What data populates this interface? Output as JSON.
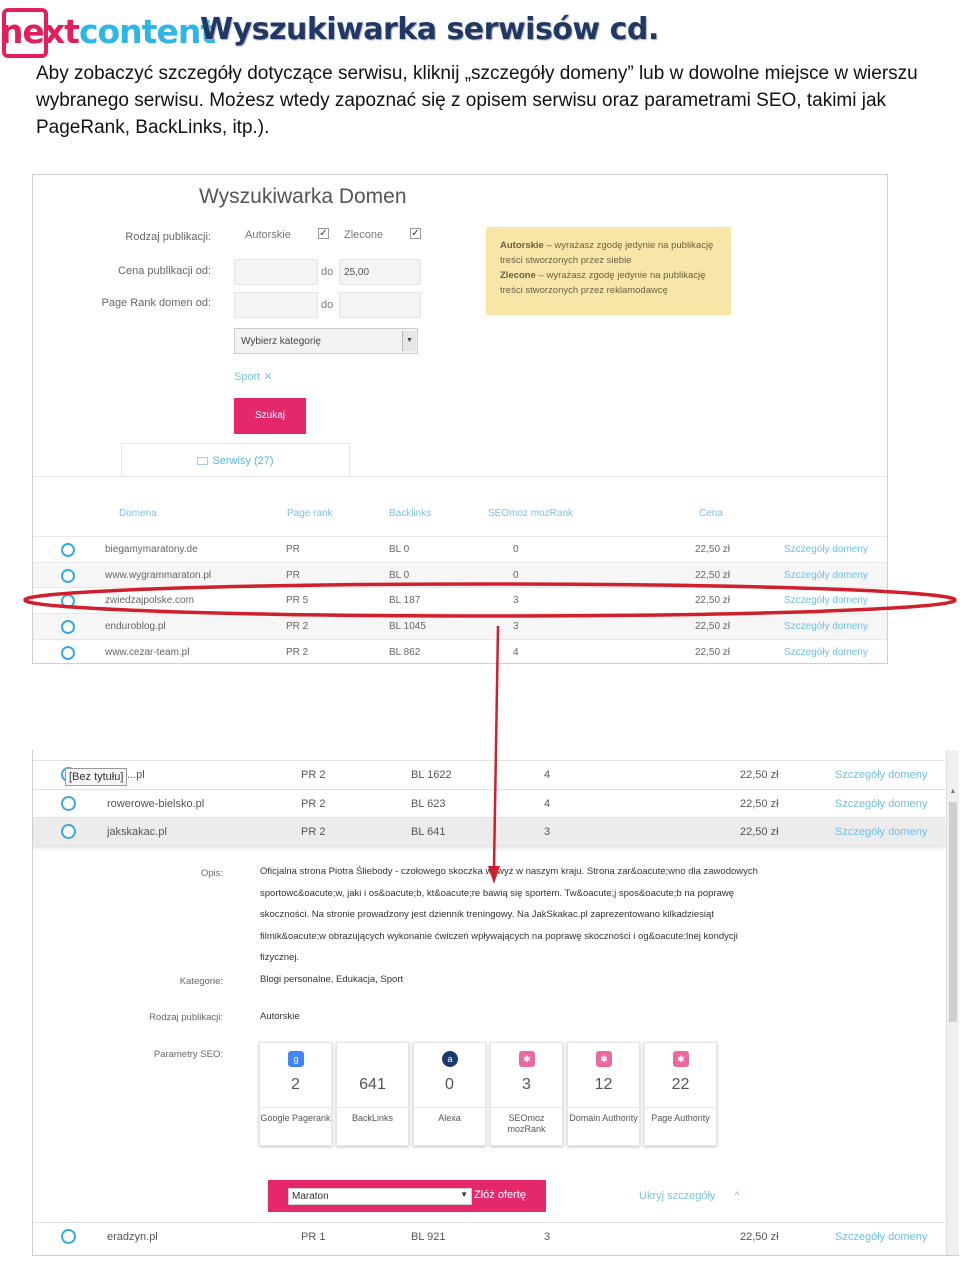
{
  "header": {
    "logo_part1": "next",
    "logo_part2": "content",
    "title": "Wyszukiwarka serwisów cd.",
    "intro": "Aby zobaczyć szczegóły dotyczące serwisu, kliknij „szczegóły domeny” lub w dowolne miejsce w wierszu wybranego serwisu. Możesz wtedy zapoznać się z opisem serwisu oraz parametrami SEO, takimi jak PageRank, BackLinks, itp.)."
  },
  "search": {
    "title": "Wyszukiwarka Domen",
    "pub_type_label": "Rodzaj publikacji:",
    "opt_autorskie": "Autorskie",
    "opt_zlecone": "Zlecone",
    "price_label": "Cena publikacji od:",
    "price_to_label": "do",
    "price_to_value": "25,00",
    "pagerank_label": "Page Rank domen od:",
    "pagerank_to_label": "do",
    "category_select": "Wybierz kategorię",
    "category_tag": "Sport ✕",
    "search_button": "Szukaj",
    "note_autorskie_title": "Autorskie",
    "note_autorskie_text": " – wyrażasz zgodę jedynie na publikację treści stworzonych przez siebie",
    "note_zlecone_title": "Zlecone",
    "note_zlecone_text": " – wyrażasz zgodę jedynie na publikację treści stworzonych przez reklamodawcę",
    "tab_label": "Serwisy (27)"
  },
  "table1": {
    "columns": [
      "Domena",
      "Page rank",
      "Backlinks",
      "SEOmoz mozRank",
      "Cena"
    ],
    "rows": [
      {
        "domain": "biegamymaratony.de",
        "pr": "PR",
        "bl": "BL 0",
        "moz": "0",
        "price": "22,50 zł",
        "link": "Szczegóły domeny"
      },
      {
        "domain": "www.wygrammaraton.pl",
        "pr": "PR",
        "bl": "BL 0",
        "moz": "0",
        "price": "22,50 zł",
        "link": "Szczegóły domeny"
      },
      {
        "domain": "zwiedzajpolske.com",
        "pr": "PR 5",
        "bl": "BL 187",
        "moz": "3",
        "price": "22,50 zł",
        "link": "Szczegóły domeny"
      },
      {
        "domain": "enduroblog.pl",
        "pr": "PR 2",
        "bl": "BL 1045",
        "moz": "3",
        "price": "22,50 zł",
        "link": "Szczegóły domeny"
      },
      {
        "domain": "www.cezar-team.pl",
        "pr": "PR 2",
        "bl": "BL 862",
        "moz": "4",
        "price": "22,50 zł",
        "link": "Szczegóły domeny"
      }
    ]
  },
  "table2": {
    "tooltip": "[Bez tytułu]",
    "rows": [
      {
        "domain": "...pl",
        "pr": "PR 2",
        "bl": "BL 1622",
        "moz": "4",
        "price": "22,50 zł",
        "link": "Szczegóły domeny"
      },
      {
        "domain": "rowerowe-bielsko.pl",
        "pr": "PR 2",
        "bl": "BL 623",
        "moz": "4",
        "price": "22,50 zł",
        "link": "Szczegóły domeny"
      },
      {
        "domain": "jakskakac.pl",
        "pr": "PR 2",
        "bl": "BL 641",
        "moz": "3",
        "price": "22,50 zł",
        "link": "Szczegóły domeny"
      }
    ],
    "last_row": {
      "domain": "eradzyn.pl",
      "pr": "PR 1",
      "bl": "BL 921",
      "moz": "3",
      "price": "22,50 zł",
      "link": "Szczegóły domeny"
    }
  },
  "details": {
    "opis_label": "Opis:",
    "opis_text": "Oficjalna strona Piotra Śliebody - czołowego skoczka wzwyż w naszym kraju. Strona zar&oacute;wno dla zawodowych sportowc&oacute;w, jaki i os&oacute;b, kt&oacute;re bawią się sportem. Tw&oacute;j spos&oacute;b na poprawę skoczności. Na stronie prowadzony jest dziennik treningowy. Na JakSkakac.pl zaprezentowano kilkadziesiąt filmik&oacute;w obrazujących wykonanie ćwiczeń wpływających na poprawę skoczności i og&oacute;lnej kondycji fizycznej.",
    "kategorie_label": "Kategorie:",
    "kategorie_text": "Blogi personalne, Edukacja, Sport",
    "rodzaj_label": "Rodzaj publikacji:",
    "rodzaj_text": "Autorskie",
    "seo_label": "Parametry SEO:",
    "seo": [
      {
        "value": "2",
        "caption": "Google Pagerank",
        "icon": "google-icon"
      },
      {
        "value": "641",
        "caption": "BackLinks",
        "icon": "none"
      },
      {
        "value": "0",
        "caption": "Alexa",
        "icon": "alexa-icon"
      },
      {
        "value": "3",
        "caption": "SEOmoz mozRank",
        "icon": "moz-icon"
      },
      {
        "value": "12",
        "caption": "Domain Authority",
        "icon": "moz-icon"
      },
      {
        "value": "22",
        "caption": "Page Authority",
        "icon": "moz-icon"
      }
    ],
    "offer_select": "Maraton",
    "offer_button": "Złóż ofertę",
    "hide_details": "Ukryj szczegóły"
  },
  "colors": {
    "accent": "#e5286b",
    "link": "#6cbfe8",
    "highlight": "#d0202e",
    "title": "#1f3864"
  }
}
